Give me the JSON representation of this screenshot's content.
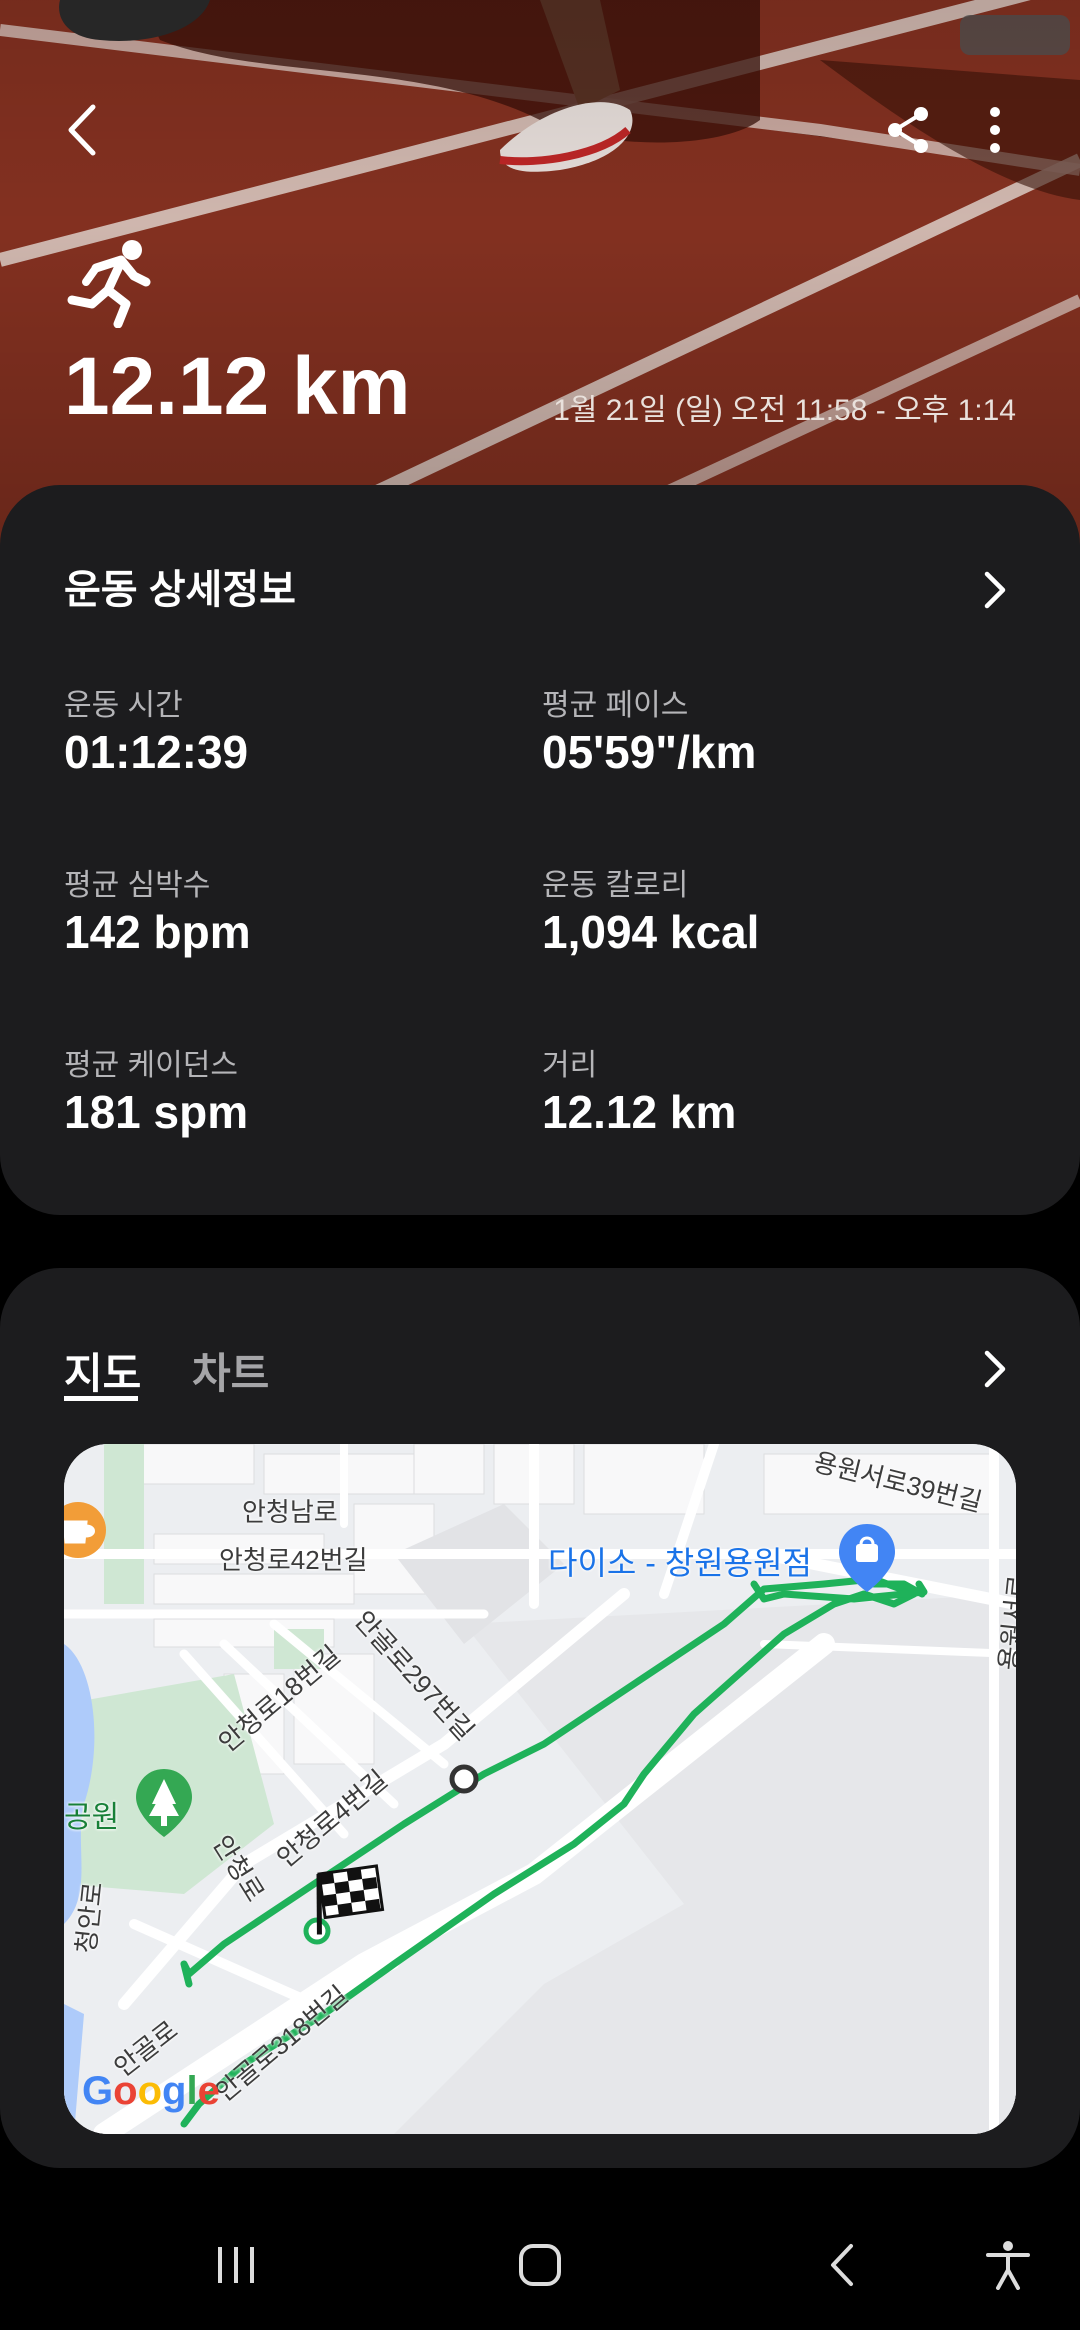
{
  "header": {
    "distance": "12.12 km",
    "date_range": "1월 21일 (일) 오전 11:58 - 오후 1:14",
    "icons": {
      "back": "back-arrow-icon",
      "share": "share-icon",
      "more": "more-vert-icon",
      "activity": "running-icon"
    }
  },
  "details": {
    "title": "운동 상세정보",
    "stats": [
      {
        "label": "운동 시간",
        "value": "01:12:39"
      },
      {
        "label": "평균 페이스",
        "value": "05'59\"/km"
      },
      {
        "label": "평균 심박수",
        "value": "142 bpm"
      },
      {
        "label": "운동 칼로리",
        "value": "1,094 kcal"
      },
      {
        "label": "평균 케이던스",
        "value": "181 spm"
      },
      {
        "label": "거리",
        "value": "12.12 km"
      }
    ]
  },
  "map_section": {
    "tabs": [
      "지도",
      "차트"
    ],
    "active_tab": "지도",
    "labels": {
      "l1": "안청남로",
      "l2": "안청로42번길",
      "l3": "다이소 - 창원용원점",
      "l4": "용원서로39번길",
      "l5": "안청로18번길",
      "l6": "안골로297번길",
      "l7": "안청로4번길",
      "l8": "안청로",
      "l9": "공원",
      "l10": "안골로",
      "l11": "안골로318번길",
      "l12": "청안로",
      "l13": "용원서로"
    },
    "google": "Google",
    "route_color": "#1fb25a"
  },
  "navbar": {
    "icons": [
      "recent-apps-icon",
      "home-icon",
      "back-icon",
      "accessibility-icon"
    ]
  }
}
